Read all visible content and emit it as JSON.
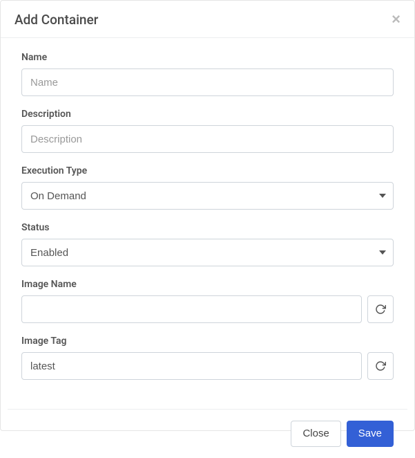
{
  "header": {
    "title": "Add Container",
    "close_glyph": "×"
  },
  "form": {
    "name": {
      "label": "Name",
      "placeholder": "Name",
      "value": ""
    },
    "description": {
      "label": "Description",
      "placeholder": "Description",
      "value": ""
    },
    "execution_type": {
      "label": "Execution Type",
      "selected": "On Demand"
    },
    "status": {
      "label": "Status",
      "selected": "Enabled"
    },
    "image_name": {
      "label": "Image Name",
      "value": ""
    },
    "image_tag": {
      "label": "Image Tag",
      "value": "latest"
    }
  },
  "footer": {
    "close_label": "Close",
    "save_label": "Save"
  },
  "colors": {
    "primary": "#3360d6",
    "border": "#ced4da",
    "text": "#4a4a4a"
  }
}
